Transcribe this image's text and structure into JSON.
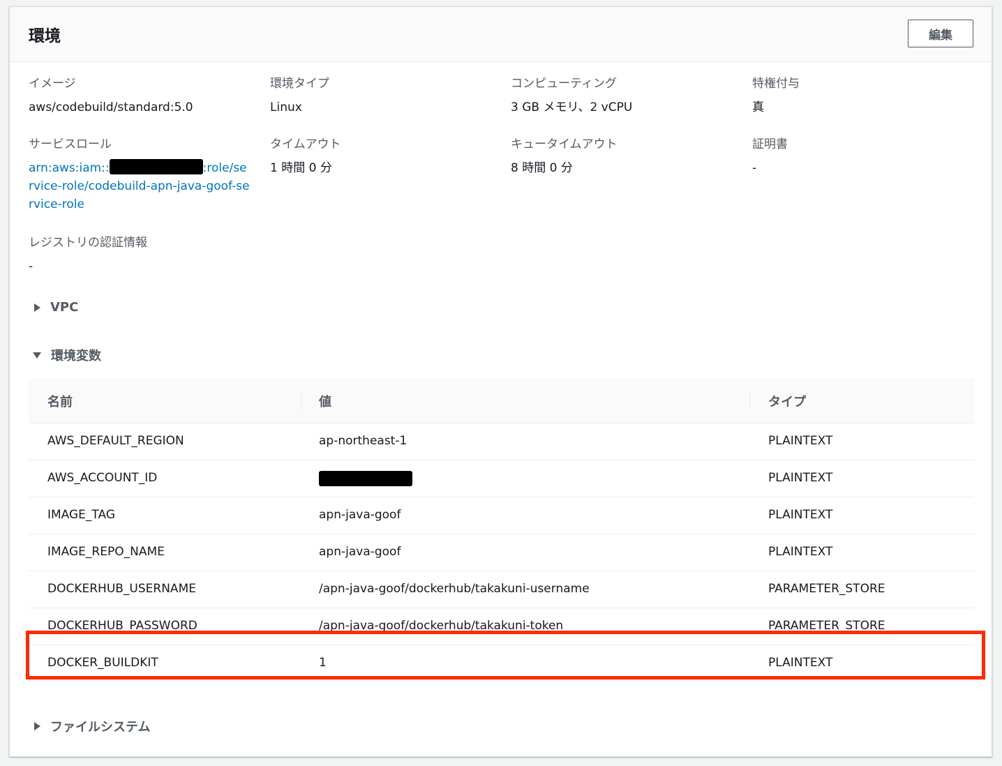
{
  "panel": {
    "title": "環境",
    "edit_label": "編集"
  },
  "fields": {
    "image": {
      "label": "イメージ",
      "value": "aws/codebuild/standard:5.0"
    },
    "env_type": {
      "label": "環境タイプ",
      "value": "Linux"
    },
    "compute": {
      "label": "コンピューティング",
      "value": "3 GB メモリ、2 vCPU"
    },
    "privileged": {
      "label": "特権付与",
      "value": "真"
    },
    "service_role": {
      "label": "サービスロール",
      "value_prefix": "arn:aws:iam::",
      "value_suffix": ":role/service-role/codebuild-apn-java-goof-service-role"
    },
    "timeout": {
      "label": "タイムアウト",
      "value": "1 時間 0 分"
    },
    "queue_timeout": {
      "label": "キュータイムアウト",
      "value": "8 時間 0 分"
    },
    "certificate": {
      "label": "証明書",
      "value": "-"
    },
    "registry_credential": {
      "label": "レジストリの認証情報",
      "value": "-"
    }
  },
  "sections": {
    "vpc": "VPC",
    "env_vars": "環境変数",
    "file_system": "ファイルシステム"
  },
  "env_table": {
    "headers": {
      "name": "名前",
      "value": "値",
      "type": "タイプ"
    },
    "rows": [
      {
        "name": "AWS_DEFAULT_REGION",
        "value": "ap-northeast-1",
        "type": "PLAINTEXT",
        "redacted": false
      },
      {
        "name": "AWS_ACCOUNT_ID",
        "value": "",
        "type": "PLAINTEXT",
        "redacted": true
      },
      {
        "name": "IMAGE_TAG",
        "value": "apn-java-goof",
        "type": "PLAINTEXT",
        "redacted": false
      },
      {
        "name": "IMAGE_REPO_NAME",
        "value": "apn-java-goof",
        "type": "PLAINTEXT",
        "redacted": false
      },
      {
        "name": "DOCKERHUB_USERNAME",
        "value": "/apn-java-goof/dockerhub/takakuni-username",
        "type": "PARAMETER_STORE",
        "redacted": false
      },
      {
        "name": "DOCKERHUB_PASSWORD",
        "value": "/apn-java-goof/dockerhub/takakuni-token",
        "type": "PARAMETER_STORE",
        "redacted": false
      },
      {
        "name": "DOCKER_BUILDKIT",
        "value": "1",
        "type": "PLAINTEXT",
        "redacted": false
      }
    ]
  },
  "colors": {
    "link": "#0073bb",
    "highlight": "#ff2a00"
  }
}
